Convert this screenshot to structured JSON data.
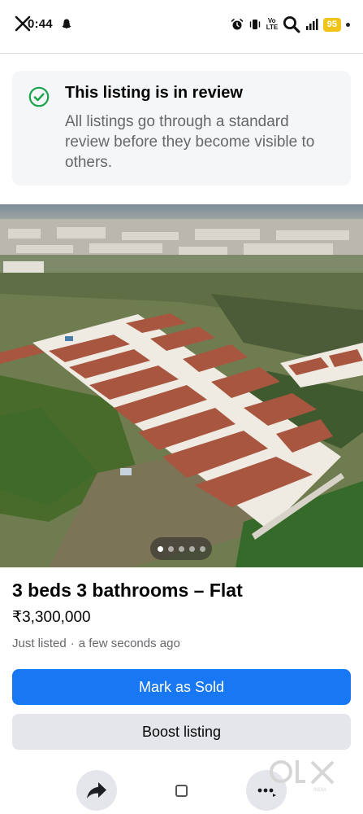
{
  "status_bar": {
    "time": "0:44",
    "volte": "Vo LTE",
    "battery": "95",
    "close_icon": "close-icon",
    "notification_icon": "snapchat-ghost-icon",
    "alarm_icon": "alarm-icon",
    "vibrate_icon": "vibrate-icon",
    "search_icon": "search-icon",
    "signal_icon": "signal-icon"
  },
  "review": {
    "icon": "check-circle-icon",
    "title": "This listing is in review",
    "body": "All listings go through a standard review before they become visible to others."
  },
  "photo": {
    "description_icon": "listing-photo",
    "carousel": {
      "count": 5,
      "active_index": 0
    }
  },
  "listing": {
    "title": "3 beds 3 bathrooms – Flat",
    "price": "₹3,300,000",
    "status": "Just listed",
    "separator": "·",
    "time": "a few seconds ago"
  },
  "actions": {
    "mark_sold": "Mark as Sold",
    "boost": "Boost listing"
  },
  "bottom_nav": {
    "share_icon": "share-icon",
    "home_icon": "home-square-icon",
    "more_icon": "more-icon"
  },
  "watermark": {
    "text": "olx",
    "sub": "INDIA"
  },
  "colors": {
    "primary": "#1877f2",
    "secondary": "#e4e6eb",
    "check_green": "#1aa34a",
    "battery": "#f0c419",
    "card_bg": "#f5f6f7"
  }
}
